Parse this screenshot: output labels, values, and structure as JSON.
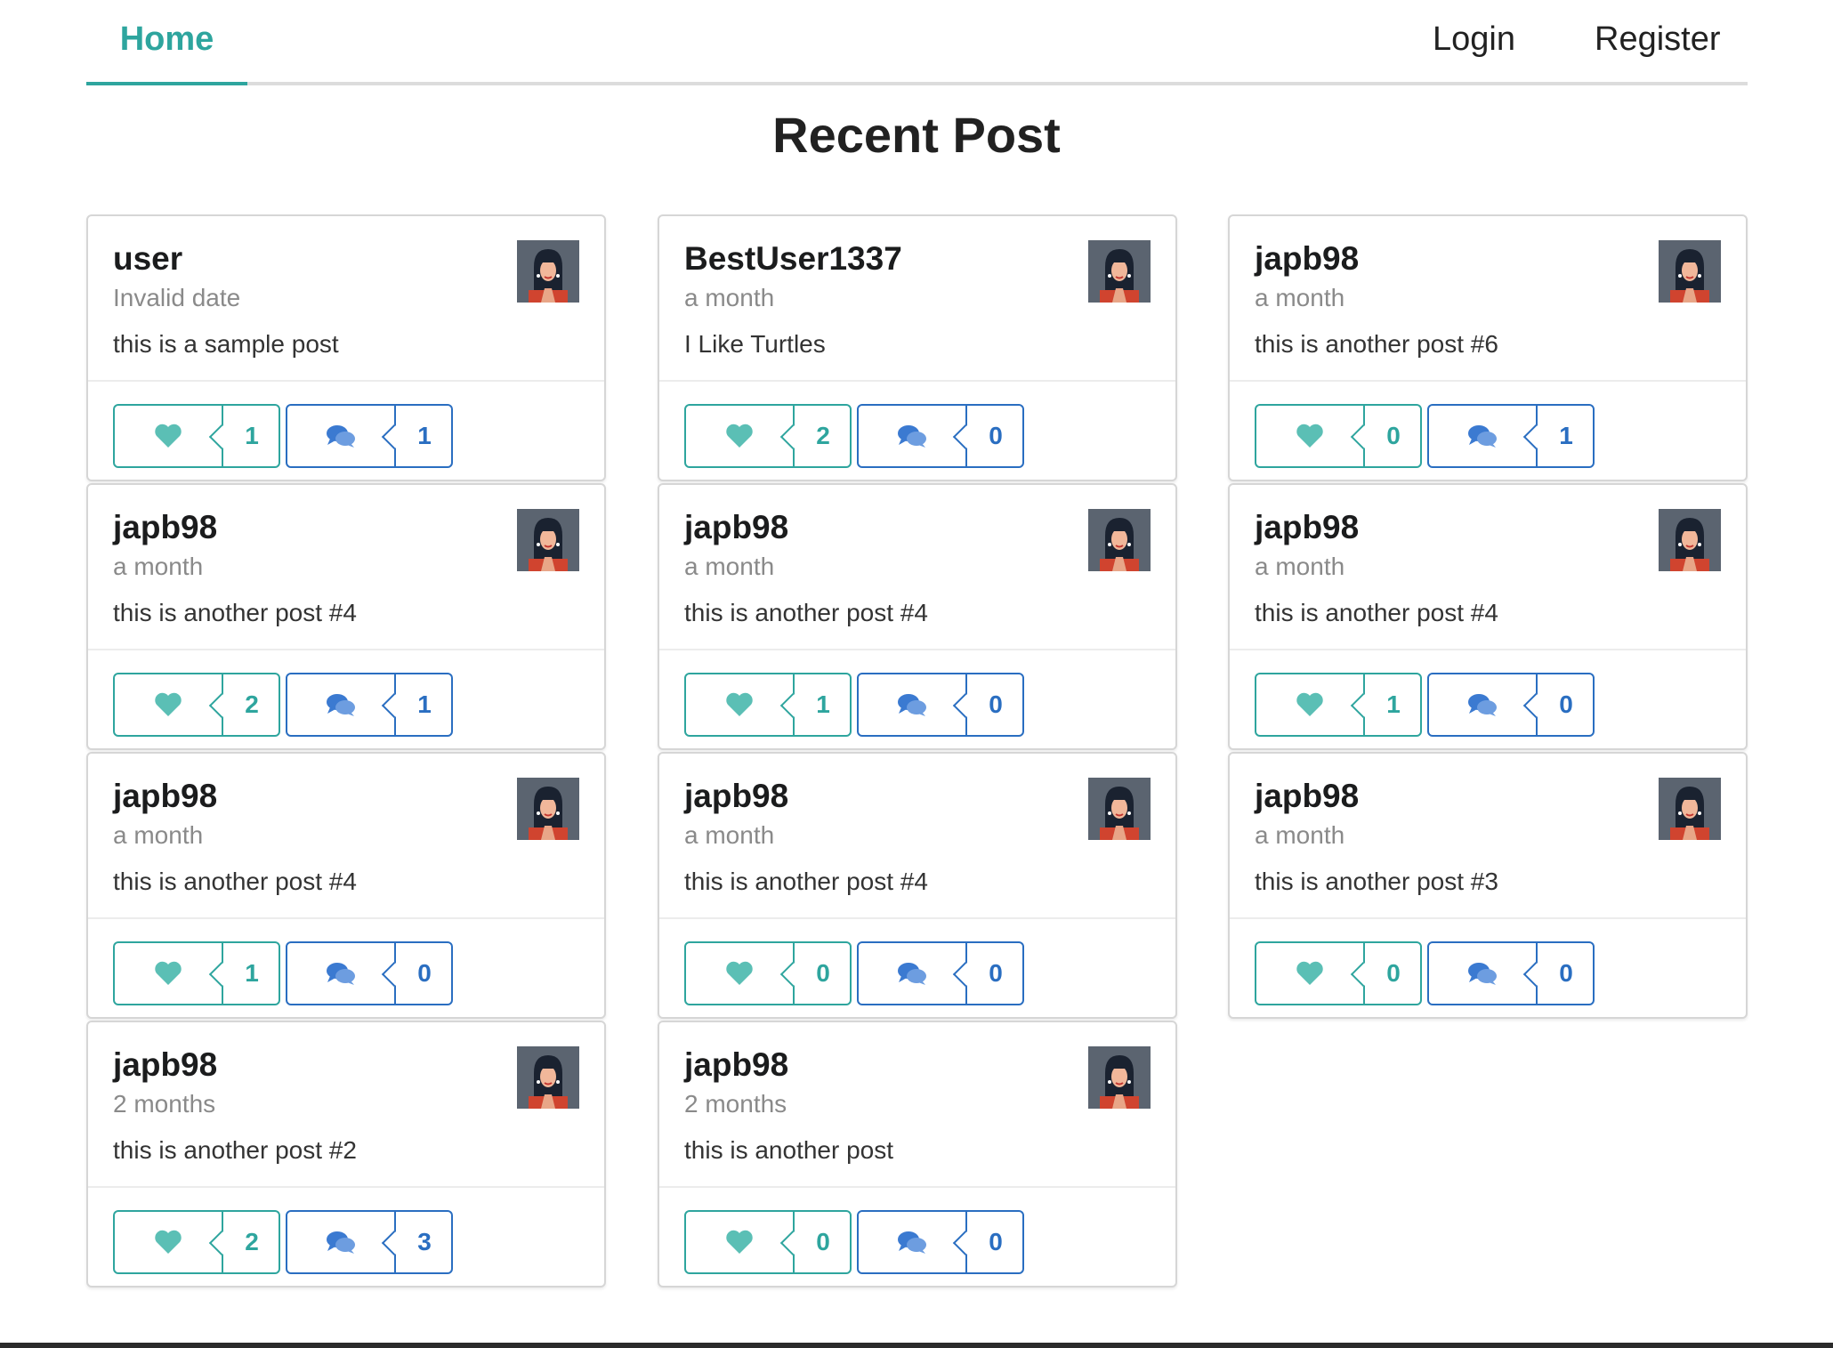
{
  "nav": {
    "home_label": "Home",
    "login_label": "Login",
    "register_label": "Register",
    "accent_color": "#2ea59e"
  },
  "page": {
    "title": "Recent Post"
  },
  "colors": {
    "like": "#2ea59e",
    "comment": "#2a6ec1"
  },
  "posts": [
    {
      "username": "user",
      "time": "Invalid date",
      "body": "this is a sample post",
      "likes": "1",
      "comments": "1"
    },
    {
      "username": "BestUser1337",
      "time": "a month",
      "body": "I Like Turtles",
      "likes": "2",
      "comments": "0"
    },
    {
      "username": "japb98",
      "time": "a month",
      "body": "this is another post #6",
      "likes": "0",
      "comments": "1"
    },
    {
      "username": "japb98",
      "time": "a month",
      "body": "this is another post #4",
      "likes": "2",
      "comments": "1"
    },
    {
      "username": "japb98",
      "time": "a month",
      "body": "this is another post #4",
      "likes": "1",
      "comments": "0"
    },
    {
      "username": "japb98",
      "time": "a month",
      "body": "this is another post #4",
      "likes": "1",
      "comments": "0"
    },
    {
      "username": "japb98",
      "time": "a month",
      "body": "this is another post #4",
      "likes": "1",
      "comments": "0"
    },
    {
      "username": "japb98",
      "time": "a month",
      "body": "this is another post #4",
      "likes": "0",
      "comments": "0"
    },
    {
      "username": "japb98",
      "time": "a month",
      "body": "this is another post #3",
      "likes": "0",
      "comments": "0"
    },
    {
      "username": "japb98",
      "time": "2 months",
      "body": "this is another post #2",
      "likes": "2",
      "comments": "3"
    },
    {
      "username": "japb98",
      "time": "2 months",
      "body": "this is another post",
      "likes": "0",
      "comments": "0"
    }
  ],
  "icons": {
    "like": "heart-icon",
    "comment": "comments-icon",
    "avatar": "user-avatar-image"
  }
}
